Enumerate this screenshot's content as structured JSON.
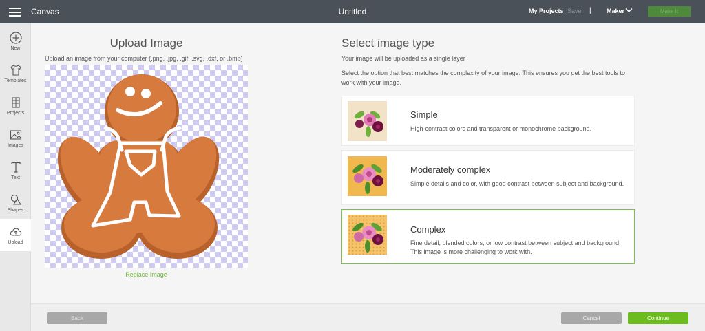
{
  "topbar": {
    "app_title": "Canvas",
    "document_title": "Untitled",
    "my_projects": "My Projects",
    "save": "Save",
    "divider": "|",
    "machine": "Maker",
    "make_it": "Make It"
  },
  "sidebar": {
    "items": [
      {
        "label": "New",
        "icon": "plus-circle-icon"
      },
      {
        "label": "Templates",
        "icon": "tshirt-icon"
      },
      {
        "label": "Projects",
        "icon": "projects-icon"
      },
      {
        "label": "Images",
        "icon": "image-icon"
      },
      {
        "label": "Text",
        "icon": "text-icon"
      },
      {
        "label": "Shapes",
        "icon": "shapes-icon"
      },
      {
        "label": "Upload",
        "icon": "cloud-upload-icon",
        "active": true
      }
    ]
  },
  "upload": {
    "title": "Upload Image",
    "subtitle": "Upload an image from your computer (.png, .jpg, .gif, .svg, .dxf, or .bmp)",
    "replace_link": "Replace Image"
  },
  "select": {
    "title": "Select image type",
    "subtitle1": "Your image will be uploaded as a single layer",
    "subtitle2": "Select the option that best matches the complexity of your image. This ensures you get the best tools to work with your image.",
    "options": [
      {
        "name": "Simple",
        "desc": "High-contrast colors and transparent or monochrome background.",
        "thumb_bg": "#f2e3c8",
        "selected": false
      },
      {
        "name": "Moderately complex",
        "desc": "Simple details and color, with good contrast between subject and background.",
        "thumb_bg": "#f0b84e",
        "selected": false
      },
      {
        "name": "Complex",
        "desc": "Fine detail, blended colors, or low contrast between subject and background. This image is more challenging to work with.",
        "thumb_bg": "#f5c46a",
        "selected": true
      }
    ]
  },
  "footer": {
    "back": "Back",
    "cancel": "Cancel",
    "continue": "Continue"
  },
  "colors": {
    "topbar": "#4a5158",
    "accent_green": "#6cbc1f",
    "selected_border": "#7bc24a",
    "cookie": "#d67a3e"
  }
}
